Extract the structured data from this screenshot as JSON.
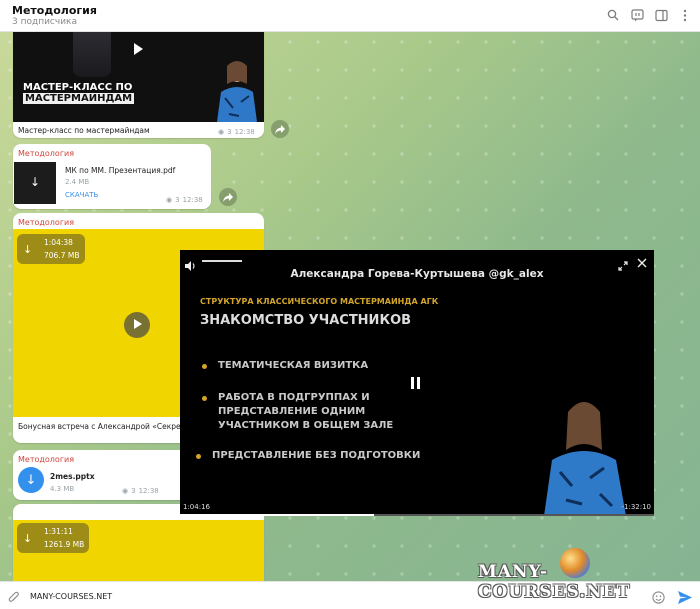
{
  "header": {
    "title": "Методология",
    "subtitle": "3 подписчика"
  },
  "messages": {
    "video1": {
      "thumb_text_line1": "МАСТЕР-КЛАСС ПО",
      "thumb_text_line2": "МАСТЕРМАИНДАМ",
      "caption": "Мастер-класс по мастермайндам",
      "views": "3",
      "time": "12:38"
    },
    "doc1": {
      "sender": "Методология",
      "file_name": "МК по ММ. Презентация.pdf",
      "size": "2.4 MB",
      "action": "СКАЧАТЬ",
      "views": "3",
      "time": "12:38"
    },
    "video2": {
      "sender": "Методология",
      "duration": "1:04:38",
      "size": "706.7 MB",
      "caption": "Бонусная встреча с Александрой «Секретны"
    },
    "doc2": {
      "sender": "Методология",
      "file_name": "2mes.pptx",
      "size": "4.3 MB",
      "views": "3",
      "time": "12:38"
    },
    "video3": {
      "duration": "1:31:11",
      "size": "1261.9 MB"
    }
  },
  "player": {
    "title": "Александра Горева-Куртышева @gk_alex",
    "slide_subtitle": "СТРУКТУРА КЛАССИЧЕСКОГО МАСТЕРМАИНДА АГК",
    "slide_title": "ЗНАКОМСТВО УЧАСТНИКОВ",
    "bullet1": "ТЕМАТИЧЕСКАЯ ВИЗИТКА",
    "bullet2_l1": "РАБОТА В ПОДГРУППАХ И",
    "bullet2_l2": "ПРЕДСТАВЛЕНИЕ ОДНИМ",
    "bullet2_l3": "УЧАСТНИКОМ В ОБЩЕМ ЗАЛЕ",
    "bullet3": "ПРЕДСТАВЛЕНИЕ БЕЗ ПОДГОТОВКИ",
    "time_current": "1:04:16",
    "time_remaining": "-1:32:10",
    "progress": 0.41
  },
  "composer": {
    "value": "MANY-COURSES.NET"
  },
  "watermark": "MANY-COURSES.NET",
  "colors": {
    "accent": "#3390ec",
    "sender": "#d0453a",
    "slide_gold": "#d2a52a",
    "yellow": "#f0d500"
  }
}
